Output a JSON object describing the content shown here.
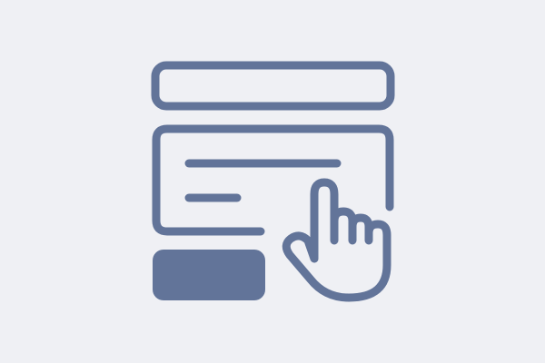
{
  "illustration": {
    "icons": {
      "top_bar": "top-bar-icon",
      "form_panel": "form-panel-icon",
      "submit_button": "submit-button-icon",
      "pointer": "pointing-hand-icon"
    },
    "colors": {
      "background": "#eff0f4",
      "stroke": "#627499",
      "fill": "#627499"
    }
  }
}
